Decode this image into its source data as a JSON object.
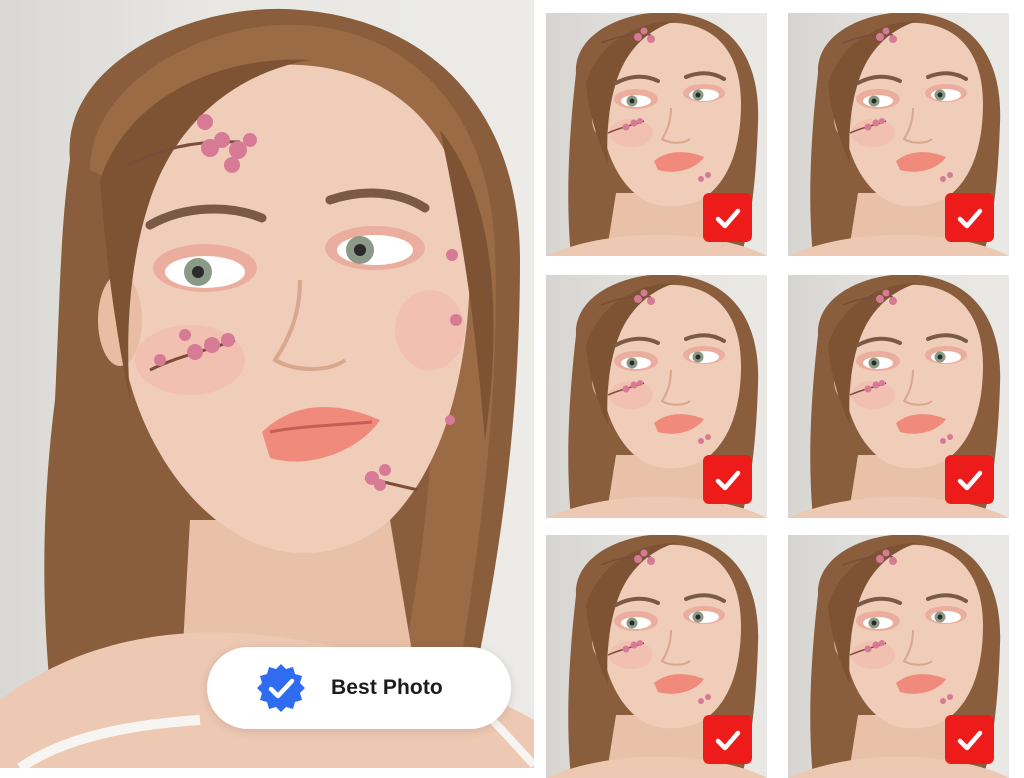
{
  "badge": {
    "label": "Best Photo",
    "icon": "verified-badge-icon",
    "icon_color": "#2f6cf0"
  },
  "thumbnails": [
    {
      "selected": true
    },
    {
      "selected": true
    },
    {
      "selected": true
    },
    {
      "selected": true
    },
    {
      "selected": true
    },
    {
      "selected": true
    }
  ],
  "colors": {
    "check_background": "#ee1b1b",
    "badge_background": "#ffffff"
  },
  "icons": {
    "check": "checkmark-icon"
  }
}
